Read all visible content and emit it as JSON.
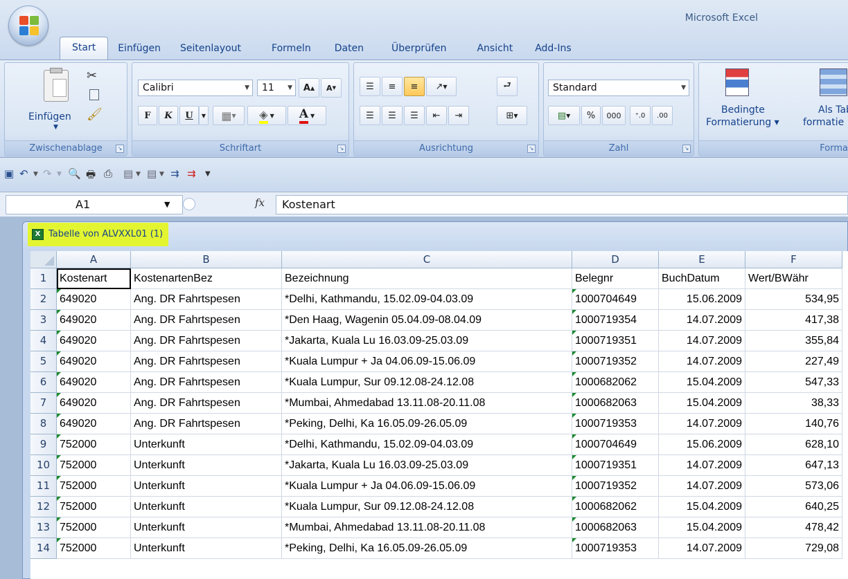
{
  "app": {
    "title": "Microsoft Excel"
  },
  "tabs": [
    "Start",
    "Einfügen",
    "Seitenlayout",
    "Formeln",
    "Daten",
    "Überprüfen",
    "Ansicht",
    "Add-Ins"
  ],
  "ribbon": {
    "clipboard": {
      "label": "Zwischenablage",
      "paste": "Einfügen"
    },
    "font": {
      "label": "Schriftart",
      "name": "Calibri",
      "size": "11",
      "bold": "F",
      "italic": "K",
      "underline": "U"
    },
    "alignment": {
      "label": "Ausrichtung"
    },
    "number": {
      "label": "Zahl",
      "format": "Standard",
      "percent": "%",
      "thousands": "000"
    },
    "styles": {
      "label": "Forma",
      "conditional": "Bedingte",
      "conditional2": "Formatierung",
      "astable": "Als Tab",
      "astable2": "formatie"
    }
  },
  "formula_bar": {
    "cell_ref": "A1",
    "fx": "fx",
    "content": "Kostenart"
  },
  "workbook": {
    "title": "Tabelle von ALVXXL01 (1)"
  },
  "columns": [
    "A",
    "B",
    "C",
    "D",
    "E",
    "F"
  ],
  "rows": [
    {
      "n": "1",
      "a": "Kostenart",
      "b": "KostenartenBez",
      "c": "Bezeichnung",
      "d": "Belegnr",
      "e": "BuchDatum",
      "f": "Wert/BWähr"
    },
    {
      "n": "2",
      "a": "649020",
      "b": "Ang. DR Fahrtspesen",
      "c": "*Delhi, Kathmandu, 15.02.09-04.03.09",
      "d": "1000704649",
      "e": "15.06.2009",
      "f": "534,95"
    },
    {
      "n": "3",
      "a": "649020",
      "b": "Ang. DR Fahrtspesen",
      "c": "*Den Haag, Wagenin 05.04.09-08.04.09",
      "d": "1000719354",
      "e": "14.07.2009",
      "f": "417,38"
    },
    {
      "n": "4",
      "a": "649020",
      "b": "Ang. DR Fahrtspesen",
      "c": "*Jakarta, Kuala Lu 16.03.09-25.03.09",
      "d": "1000719351",
      "e": "14.07.2009",
      "f": "355,84"
    },
    {
      "n": "5",
      "a": "649020",
      "b": "Ang. DR Fahrtspesen",
      "c": "*Kuala Lumpur + Ja 04.06.09-15.06.09",
      "d": "1000719352",
      "e": "14.07.2009",
      "f": "227,49"
    },
    {
      "n": "6",
      "a": "649020",
      "b": "Ang. DR Fahrtspesen",
      "c": "*Kuala Lumpur, Sur 09.12.08-24.12.08",
      "d": "1000682062",
      "e": "15.04.2009",
      "f": "547,33"
    },
    {
      "n": "7",
      "a": "649020",
      "b": "Ang. DR Fahrtspesen",
      "c": "*Mumbai, Ahmedabad 13.11.08-20.11.08",
      "d": "1000682063",
      "e": "15.04.2009",
      "f": "38,33"
    },
    {
      "n": "8",
      "a": "649020",
      "b": "Ang. DR Fahrtspesen",
      "c": "*Peking, Delhi, Ka 16.05.09-26.05.09",
      "d": "1000719353",
      "e": "14.07.2009",
      "f": "140,76"
    },
    {
      "n": "9",
      "a": "752000",
      "b": "Unterkunft",
      "c": "*Delhi, Kathmandu, 15.02.09-04.03.09",
      "d": "1000704649",
      "e": "15.06.2009",
      "f": "628,10"
    },
    {
      "n": "10",
      "a": "752000",
      "b": "Unterkunft",
      "c": "*Jakarta, Kuala Lu 16.03.09-25.03.09",
      "d": "1000719351",
      "e": "14.07.2009",
      "f": "647,13"
    },
    {
      "n": "11",
      "a": "752000",
      "b": "Unterkunft",
      "c": "*Kuala Lumpur + Ja 04.06.09-15.06.09",
      "d": "1000719352",
      "e": "14.07.2009",
      "f": "573,06"
    },
    {
      "n": "12",
      "a": "752000",
      "b": "Unterkunft",
      "c": "*Kuala Lumpur, Sur 09.12.08-24.12.08",
      "d": "1000682062",
      "e": "15.04.2009",
      "f": "640,25"
    },
    {
      "n": "13",
      "a": "752000",
      "b": "Unterkunft",
      "c": "*Mumbai, Ahmedabad 13.11.08-20.11.08",
      "d": "1000682063",
      "e": "15.04.2009",
      "f": "478,42"
    },
    {
      "n": "14",
      "a": "752000",
      "b": "Unterkunft",
      "c": "*Peking, Delhi, Ka 16.05.09-26.05.09",
      "d": "1000719353",
      "e": "14.07.2009",
      "f": "729,08"
    }
  ],
  "colors": {
    "highlight": "#e3f531",
    "accent": "#15428b",
    "error_triangle": "#1b8a2e"
  }
}
